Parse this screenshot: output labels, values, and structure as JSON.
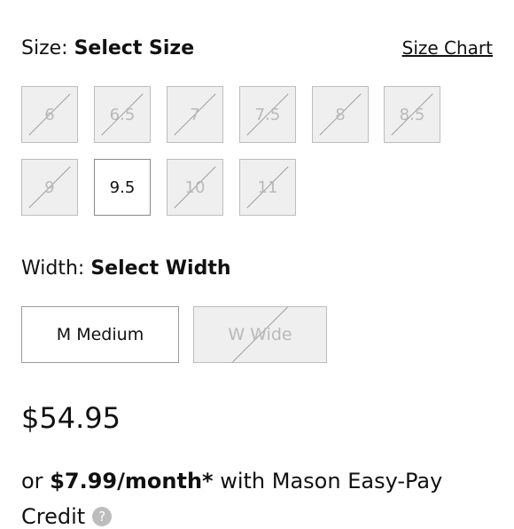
{
  "size": {
    "label": "Size:",
    "value": "Select Size",
    "chart_link": "Size Chart",
    "options": [
      {
        "label": "6",
        "available": false
      },
      {
        "label": "6.5",
        "available": false
      },
      {
        "label": "7",
        "available": false
      },
      {
        "label": "7.5",
        "available": false
      },
      {
        "label": "8",
        "available": false
      },
      {
        "label": "8.5",
        "available": false
      },
      {
        "label": "9",
        "available": false
      },
      {
        "label": "9.5",
        "available": true
      },
      {
        "label": "10",
        "available": false
      },
      {
        "label": "11",
        "available": false
      }
    ]
  },
  "width": {
    "label": "Width:",
    "value": "Select Width",
    "options": [
      {
        "label": "M Medium",
        "available": true
      },
      {
        "label": "W Wide",
        "available": false
      }
    ]
  },
  "price": "$54.95",
  "financing": {
    "prefix": "or",
    "amount": "$7.99/month*",
    "suffix": "with Mason Easy-Pay",
    "line2": "Credit"
  },
  "icons": {
    "info": "info-icon"
  }
}
